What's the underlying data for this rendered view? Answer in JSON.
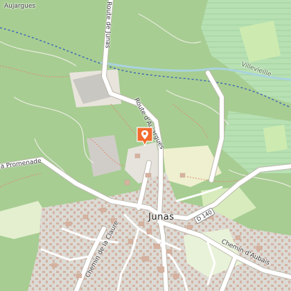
{
  "map": {
    "colors": {
      "forest": "#a7cd92",
      "land": "#f2efe9",
      "vineyard": "#b5e3b5",
      "grass": "#cdebb0",
      "urban": "#dcdad4",
      "building": "#d9b7a6",
      "road": "#ffffff",
      "path": "#f08a74",
      "rail": "#3a64b8",
      "marker": "#f26b2e"
    },
    "labels": {
      "town": "Junas",
      "route_junas": "Route de Junas",
      "route_aujargues": "Route d'Aujargues",
      "aujargues": "Aujargues",
      "villevieille": "Villevieille",
      "promenade": "a Promenade",
      "chemin_claure": "Chemin de la Claure",
      "chemin_aubais": "Chemin d'Aubais",
      "d140": "D 140"
    },
    "marker": {
      "icon": "map-pin-icon",
      "glyph": "location-pin"
    }
  }
}
